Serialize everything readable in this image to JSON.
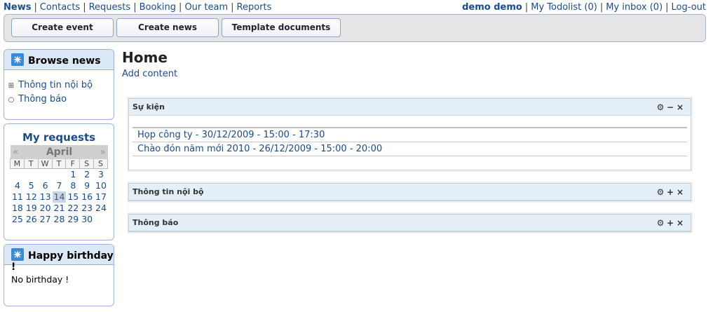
{
  "topnav": {
    "items": [
      "News",
      "Contacts",
      "Requests",
      "Booking",
      "Our team",
      "Reports"
    ],
    "active": "News"
  },
  "usernav": {
    "username": "demo demo",
    "todolist": "My Todolist (0)",
    "inbox": "My inbox (0)",
    "logout": "Log-out"
  },
  "toolbar": {
    "create_event": "Create event",
    "create_news": "Create news",
    "template_documents": "Template documents"
  },
  "browse_news": {
    "title": "Browse news",
    "items": [
      {
        "label": "Thông tin nội bộ",
        "tree": "⊞"
      },
      {
        "label": "Thông báo",
        "tree": "○"
      }
    ]
  },
  "my_requests": {
    "title": "My requests",
    "calendar": {
      "prev": "«",
      "next": "»",
      "month": "April",
      "weekdays": [
        "M",
        "T",
        "W",
        "T",
        "F",
        "S",
        "S"
      ],
      "leading_blanks": 4,
      "days_in_month": 30,
      "today": 14
    }
  },
  "birthday": {
    "title": "Happy birthday !",
    "text": "No birthday !"
  },
  "main": {
    "title": "Home",
    "add_content": "Add content",
    "portlets": [
      {
        "title": "Sự kiện",
        "controls": [
          "⚙",
          "−",
          "×"
        ],
        "events": [
          "Họp công ty - 30/12/2009 - 15:00 - 17:30",
          "Chào đón năm mới 2010 - 26/12/2009 - 15:00 - 20:00"
        ]
      },
      {
        "title": "Thông tin nội bộ",
        "controls": [
          "⚙",
          "+",
          "×"
        ]
      },
      {
        "title": "Thông báo",
        "controls": [
          "⚙",
          "+",
          "×"
        ]
      }
    ]
  },
  "colors": {
    "link": "#1a4c8c",
    "box_header": "#dbe8f6",
    "portlet_header": "#e4eff8",
    "toolbar_bg": "#e5e5e5"
  }
}
